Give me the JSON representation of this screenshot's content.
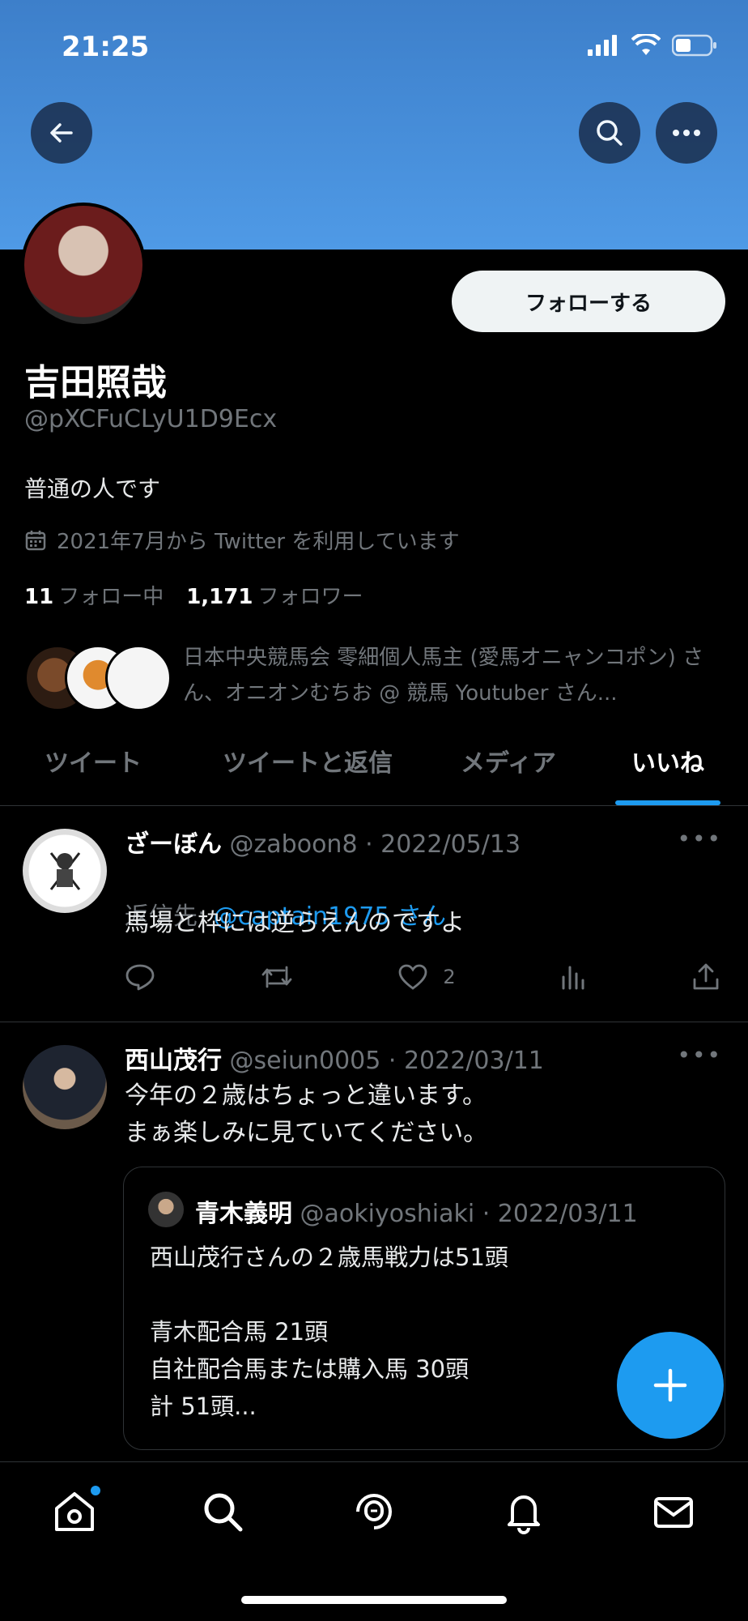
{
  "status": {
    "time": "21:25"
  },
  "profile": {
    "follow_label": "フォローする",
    "name": "吉田照哉",
    "handle": "@pXCFuCLyU1D9Ecx",
    "bio": "普通の人です",
    "joined": "2021年7月から Twitter を利用しています",
    "following_count": "11",
    "following_label": "フォロー中",
    "followers_count": "1,171",
    "followers_label": "フォロワー",
    "mutuals_text": "日本中央競馬会 零細個人馬主 (愛馬オニャンコポン) さん、オニオンむちお @ 競馬 Youtuber さん..."
  },
  "tabs": [
    {
      "label": "ツイート"
    },
    {
      "label": "ツイートと返信"
    },
    {
      "label": "メディア"
    },
    {
      "label": "いいね"
    }
  ],
  "active_tab": "いいね",
  "tweets": [
    {
      "name": "ざーぼん",
      "handle_date": "@zaboon8 · 2022/05/13",
      "reply_prefix": "返信先: ",
      "reply_target": "@captain1975 さん",
      "text": "馬場と枠には逆らえんのですよ",
      "like_count": "2"
    },
    {
      "name": "西山茂行",
      "handle_date": "@seiun0005 · 2022/03/11",
      "text": "今年の２歳はちょっと違います。\nまぁ楽しみに見ていてください。",
      "quote": {
        "name": "青木義明",
        "handle_date": "@aokiyoshiaki · 2022/03/11",
        "text": "西山茂行さんの２歳馬戦力は51頭\n\n青木配合馬 21頭\n自社配合馬または購入馬 30頭\n計 51頭..."
      }
    }
  ],
  "more_label": "•••",
  "icons": {
    "back": "back-arrow-icon",
    "search": "search-icon",
    "more": "more-icon",
    "calendar": "calendar-icon",
    "reply": "reply-icon",
    "retweet": "retweet-icon",
    "like": "heart-icon",
    "analytics": "analytics-icon",
    "share": "share-icon",
    "compose": "compose-plus-icon",
    "home": "home-icon",
    "spaces": "spaces-icon",
    "notifications": "bell-icon",
    "messages": "mail-icon"
  },
  "colors": {
    "accent": "#1d9bf0",
    "banner": "#4f9ae6",
    "background": "#000000"
  }
}
